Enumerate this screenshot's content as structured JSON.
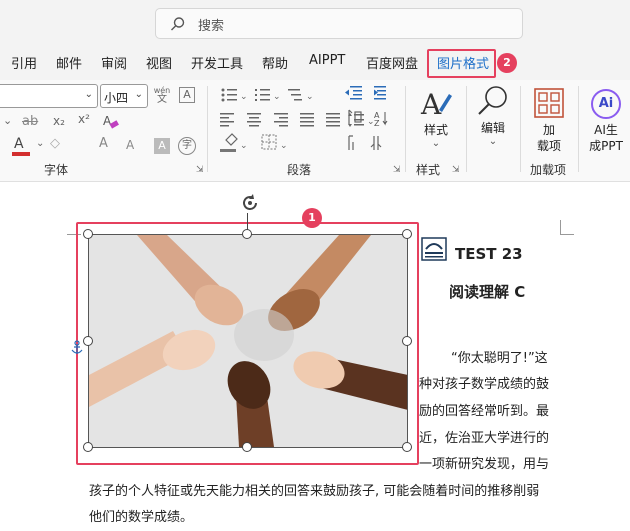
{
  "search": {
    "placeholder": "搜索"
  },
  "tabs": [
    {
      "label": "引用"
    },
    {
      "label": "邮件"
    },
    {
      "label": "审阅"
    },
    {
      "label": "视图"
    },
    {
      "label": "开发工具"
    },
    {
      "label": "帮助"
    },
    {
      "label": "AIPPT"
    },
    {
      "label": "百度网盘"
    },
    {
      "label": "图片格式"
    }
  ],
  "badges": {
    "tab": "2",
    "picture": "1"
  },
  "font_group": {
    "font_size_value": "小四",
    "wen_glyph_top": "wén",
    "wen_glyph_bottom": "文",
    "a_box": "A",
    "strike": "ab",
    "subscript": "x₂",
    "superscript": "x²",
    "font_color": "A",
    "grow_font": "A",
    "shrink_font": "A",
    "char_shading": "A",
    "enclose": "字",
    "label": "字体"
  },
  "paragraph_group": {
    "label": "段落"
  },
  "styles_group": {
    "button": "样式",
    "label": "样式"
  },
  "editing_group": {
    "button": "编辑"
  },
  "addins_group": {
    "button_line1": "加",
    "button_line2": "载项",
    "label": "加载项"
  },
  "ai_group": {
    "icon": "Ai",
    "button_line1": "AI生",
    "button_line2": "成PPT"
  },
  "document": {
    "heading1": "TEST 23",
    "heading2": "阅读理解 C",
    "lines": [
      "“你太聪明了!”这",
      "种对孩子数学成绩的鼓",
      "励的回答经常听到。最",
      "近，佐治亚大学进行的",
      "一项新研究发现，用与",
      "孩子的个人特征或先天能力相关的回答来鼓励孩子, 可能会随着时间的推移削弱",
      "他们的数学成绩。"
    ]
  },
  "colors": {
    "accent": "#e5405e",
    "tab_active": "#1e6fc9",
    "font_color_bar": "#d32f2f"
  }
}
